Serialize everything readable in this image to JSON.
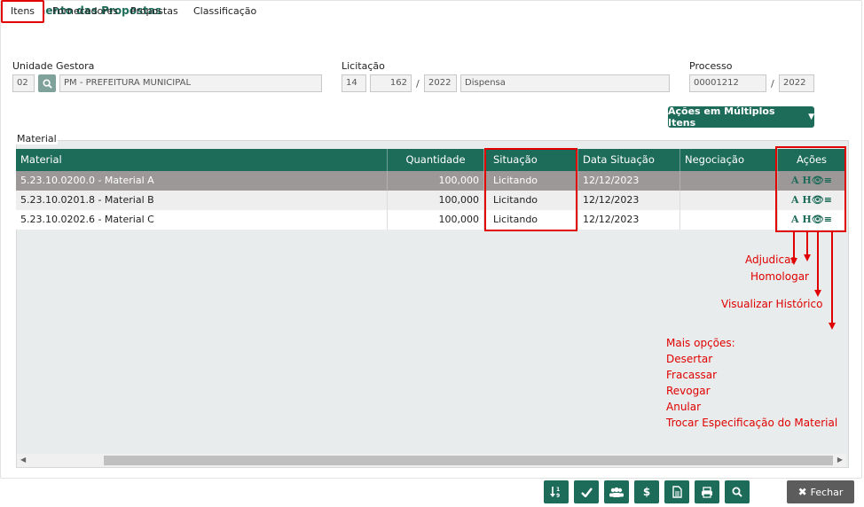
{
  "page": {
    "title": "Julgamento das Propostas"
  },
  "tabs": [
    {
      "label": "Itens",
      "active": true
    },
    {
      "label": "Fornecedores"
    },
    {
      "label": "Propostas"
    },
    {
      "label": "Classificação"
    }
  ],
  "form": {
    "unidade_label": "Unidade Gestora",
    "unidade_code": "02",
    "unidade_name": "PM - PREFEITURA MUNICIPAL",
    "licitacao_label": "Licitação",
    "lic_a": "14",
    "lic_b": "162",
    "lic_year": "2022",
    "lic_type": "Dispensa",
    "processo_label": "Processo",
    "proc_number": "00001212",
    "proc_year": "2022",
    "slash": "/"
  },
  "multi_button": "Ações em Múltiplos Itens",
  "fieldset_legend": "Material",
  "table": {
    "headers": [
      "Material",
      "Quantidade",
      "Situação",
      "Data Situação",
      "Negociação",
      "Ações"
    ],
    "rows": [
      {
        "material": "5.23.10.0200.0 - Material A",
        "quantidade": "100,000",
        "situacao": "Licitando",
        "data": "12/12/2023",
        "negociacao": "",
        "acoes": "A H"
      },
      {
        "material": "5.23.10.0201.8 - Material B",
        "quantidade": "100,000",
        "situacao": "Licitando",
        "data": "12/12/2023",
        "negociacao": "",
        "acoes": "A H"
      },
      {
        "material": "5.23.10.0202.6 - Material C",
        "quantidade": "100,000",
        "situacao": "Licitando",
        "data": "12/12/2023",
        "negociacao": "",
        "acoes": "A H"
      }
    ]
  },
  "annotations": {
    "adjudicar": "Adjudicar",
    "homologar": "Homologar",
    "visualizar": "Visualizar Histórico",
    "mais": "Mais opções:",
    "desertar": "Desertar",
    "fracassar": "Fracassar",
    "revogar": "Revogar",
    "anular": "Anular",
    "trocar": "Trocar Especificação do Material"
  },
  "toolbar": {
    "icons": [
      "sort-numeric-icon",
      "check-icon",
      "users-icon",
      "dollar-icon",
      "document-icon",
      "print-icon",
      "search-icon"
    ],
    "dollar": "$",
    "fechar": "Fechar"
  },
  "colors": {
    "accent": "#1d6b59",
    "highlight": "#e00000",
    "selected_row": "#9d9898"
  }
}
